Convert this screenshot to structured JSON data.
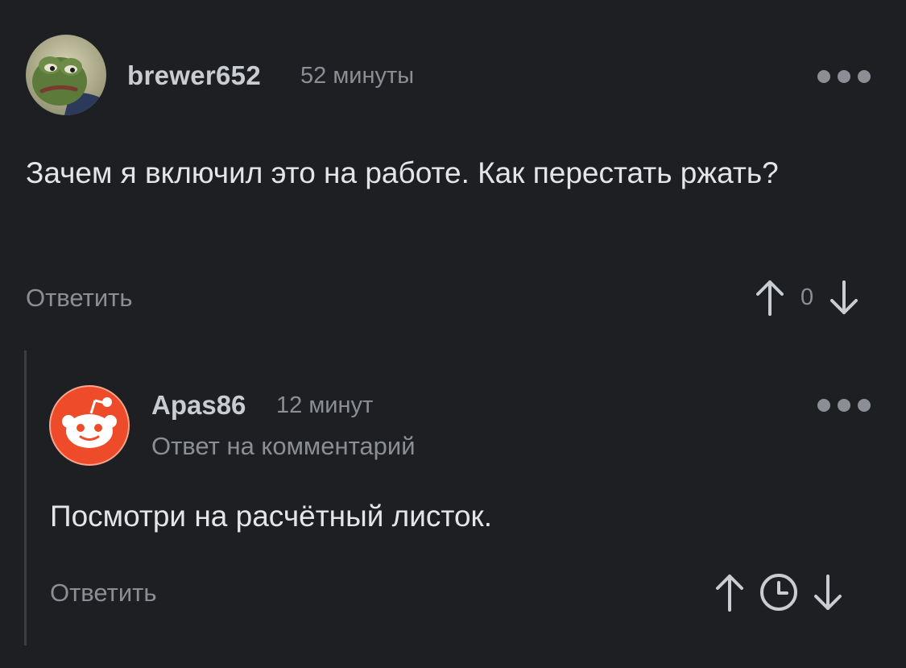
{
  "comment": {
    "username": "brewer652",
    "time": "52 минуты",
    "text": "Зачем я включил это на работе. Как перестать ржать?",
    "reply_label": "Ответить",
    "score": "0"
  },
  "reply": {
    "username": "Apas86",
    "time": "12 минут",
    "subtitle": "Ответ на комментарий",
    "text": "Посмотри на расчётный листок.",
    "reply_label": "Ответить"
  },
  "colors": {
    "background": "#1d1f22",
    "muted": "#8b8f95",
    "text": "#e3e5e8",
    "reddit_orange": "#ee4b2b"
  }
}
